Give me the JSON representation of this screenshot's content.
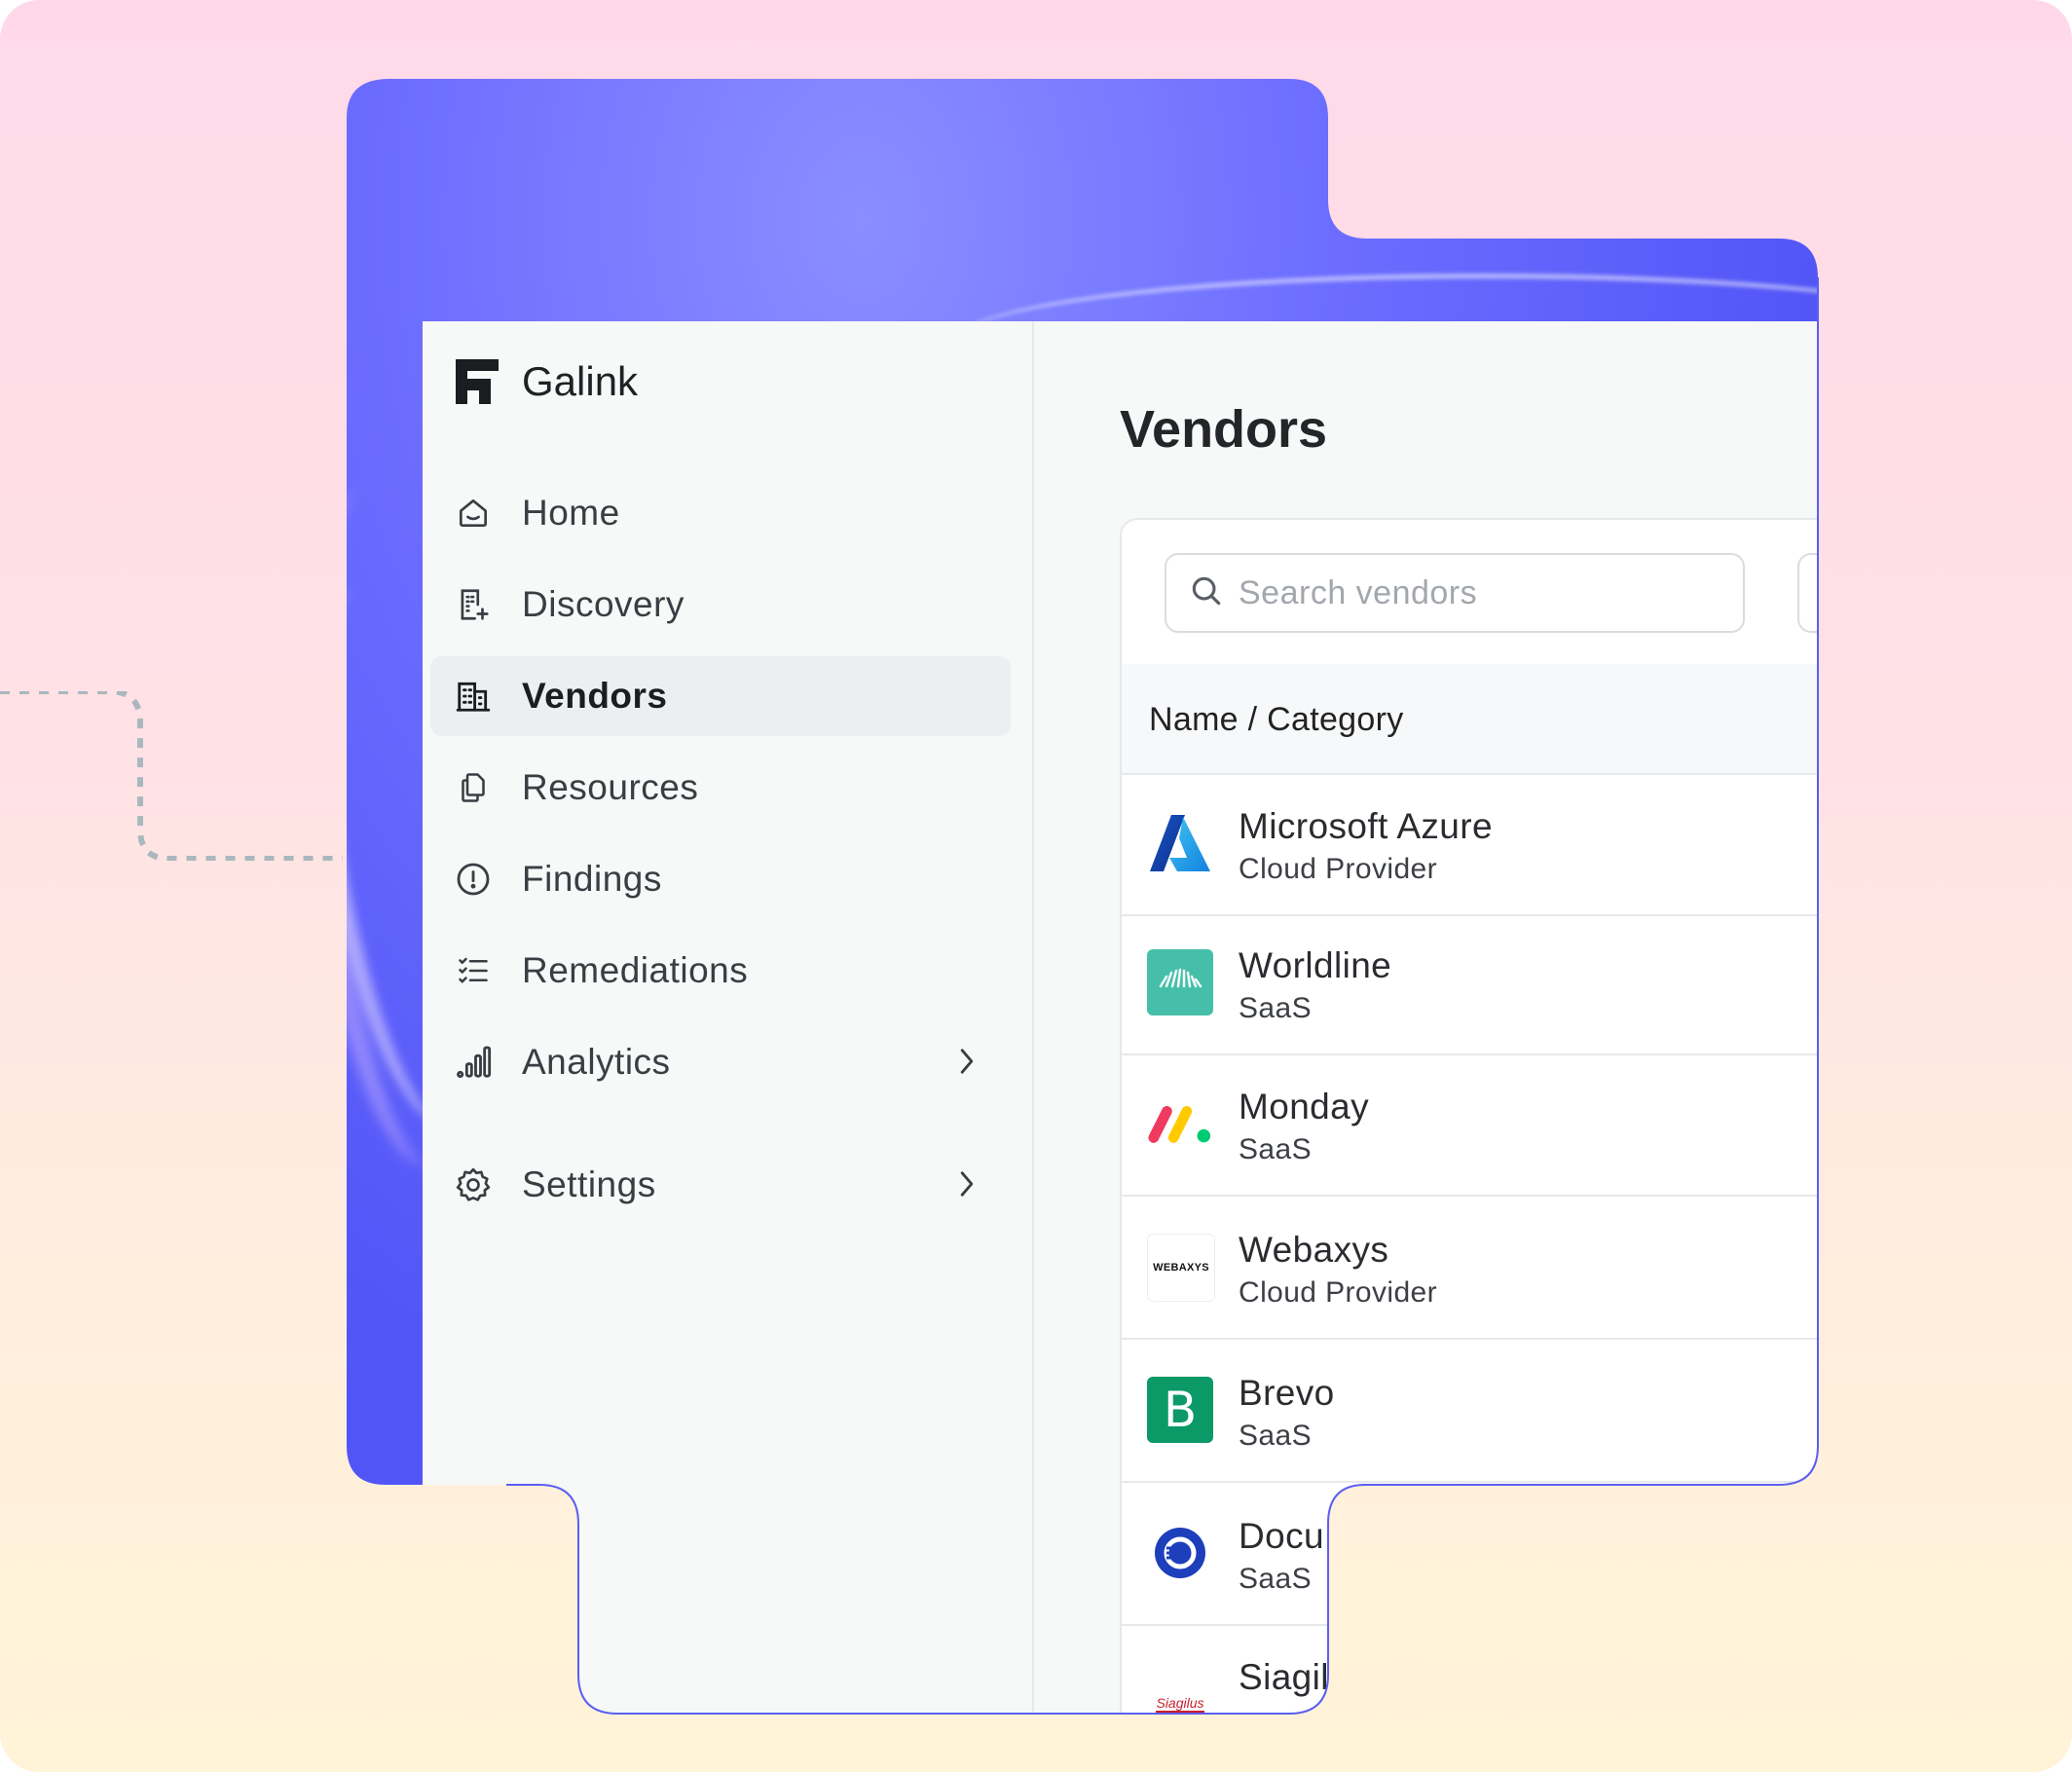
{
  "brand": {
    "name": "Galink",
    "logo_icon": "galink-logo-icon"
  },
  "sidebar": {
    "items": [
      {
        "label": "Home",
        "icon": "home-icon"
      },
      {
        "label": "Discovery",
        "icon": "building-plus-icon"
      },
      {
        "label": "Vendors",
        "icon": "buildings-icon",
        "active": true
      },
      {
        "label": "Resources",
        "icon": "documents-icon"
      },
      {
        "label": "Findings",
        "icon": "alert-circle-icon"
      },
      {
        "label": "Remediations",
        "icon": "checklist-icon"
      },
      {
        "label": "Analytics",
        "icon": "bar-chart-icon",
        "has_submenu": true
      },
      {
        "label": "Settings",
        "icon": "gear-icon",
        "has_submenu": true
      }
    ]
  },
  "main": {
    "title": "Vendors",
    "search": {
      "placeholder": "Search vendors"
    },
    "table": {
      "column_header": "Name / Category",
      "rows": [
        {
          "name": "Microsoft Azure",
          "category": "Cloud Provider",
          "logo": "azure-logo"
        },
        {
          "name": "Worldline",
          "category": "SaaS",
          "logo": "worldline-logo"
        },
        {
          "name": "Monday",
          "category": "SaaS",
          "logo": "monday-logo"
        },
        {
          "name": "Webaxys",
          "category": "Cloud Provider",
          "logo": "webaxys-logo",
          "logo_text": "WEBAXYS"
        },
        {
          "name": "Brevo",
          "category": "SaaS",
          "logo": "brevo-logo",
          "logo_text": "B"
        },
        {
          "name": "Docu",
          "category": "SaaS",
          "logo": "docusign-logo"
        },
        {
          "name": "Siagil",
          "category": "",
          "logo": "siagilus-logo",
          "logo_text": "Siagilus"
        }
      ]
    }
  },
  "colors": {
    "accent_blue": "#4f52f5",
    "background_top": "#ffd9e9",
    "background_bottom": "#fff3d8",
    "worldline": "#45bfa9",
    "brevo": "#0b9968",
    "docusign": "#1d3fbb"
  }
}
